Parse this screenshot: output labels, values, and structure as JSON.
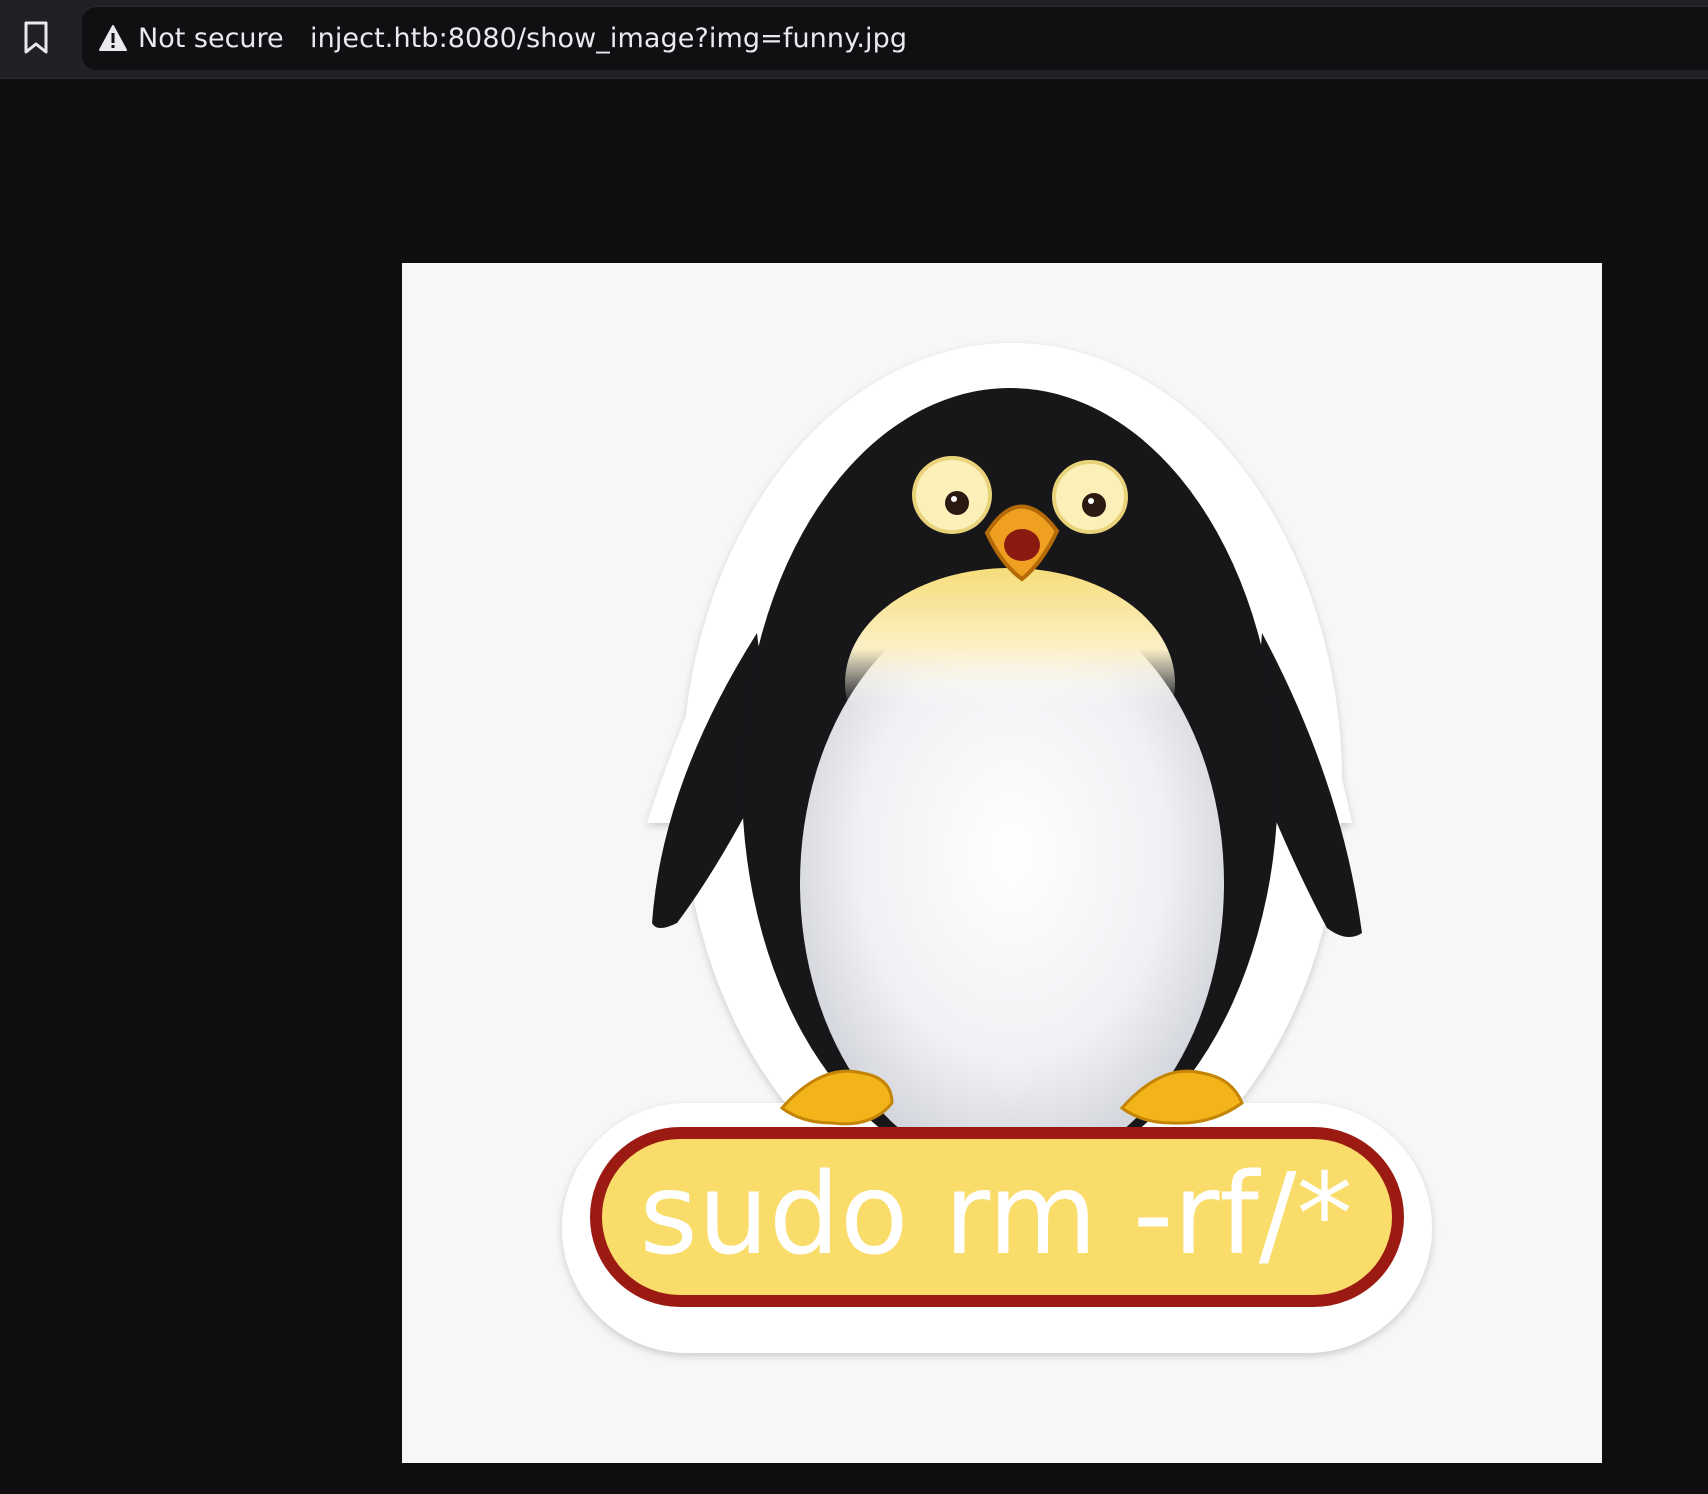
{
  "browser": {
    "security_label": "Not secure",
    "url": "inject.htb:8080/show_image?img=funny.jpg",
    "icons": {
      "bookmark": "bookmark-icon",
      "security": "warning-triangle-icon"
    }
  },
  "image": {
    "caption_text": "sudo rm -rf/*",
    "colors": {
      "badge_fill": "#f9dc6a",
      "badge_border": "#9b1a12",
      "caption": "#ffffff",
      "penguin_black": "#17171a",
      "beak": "#f0a020"
    }
  }
}
